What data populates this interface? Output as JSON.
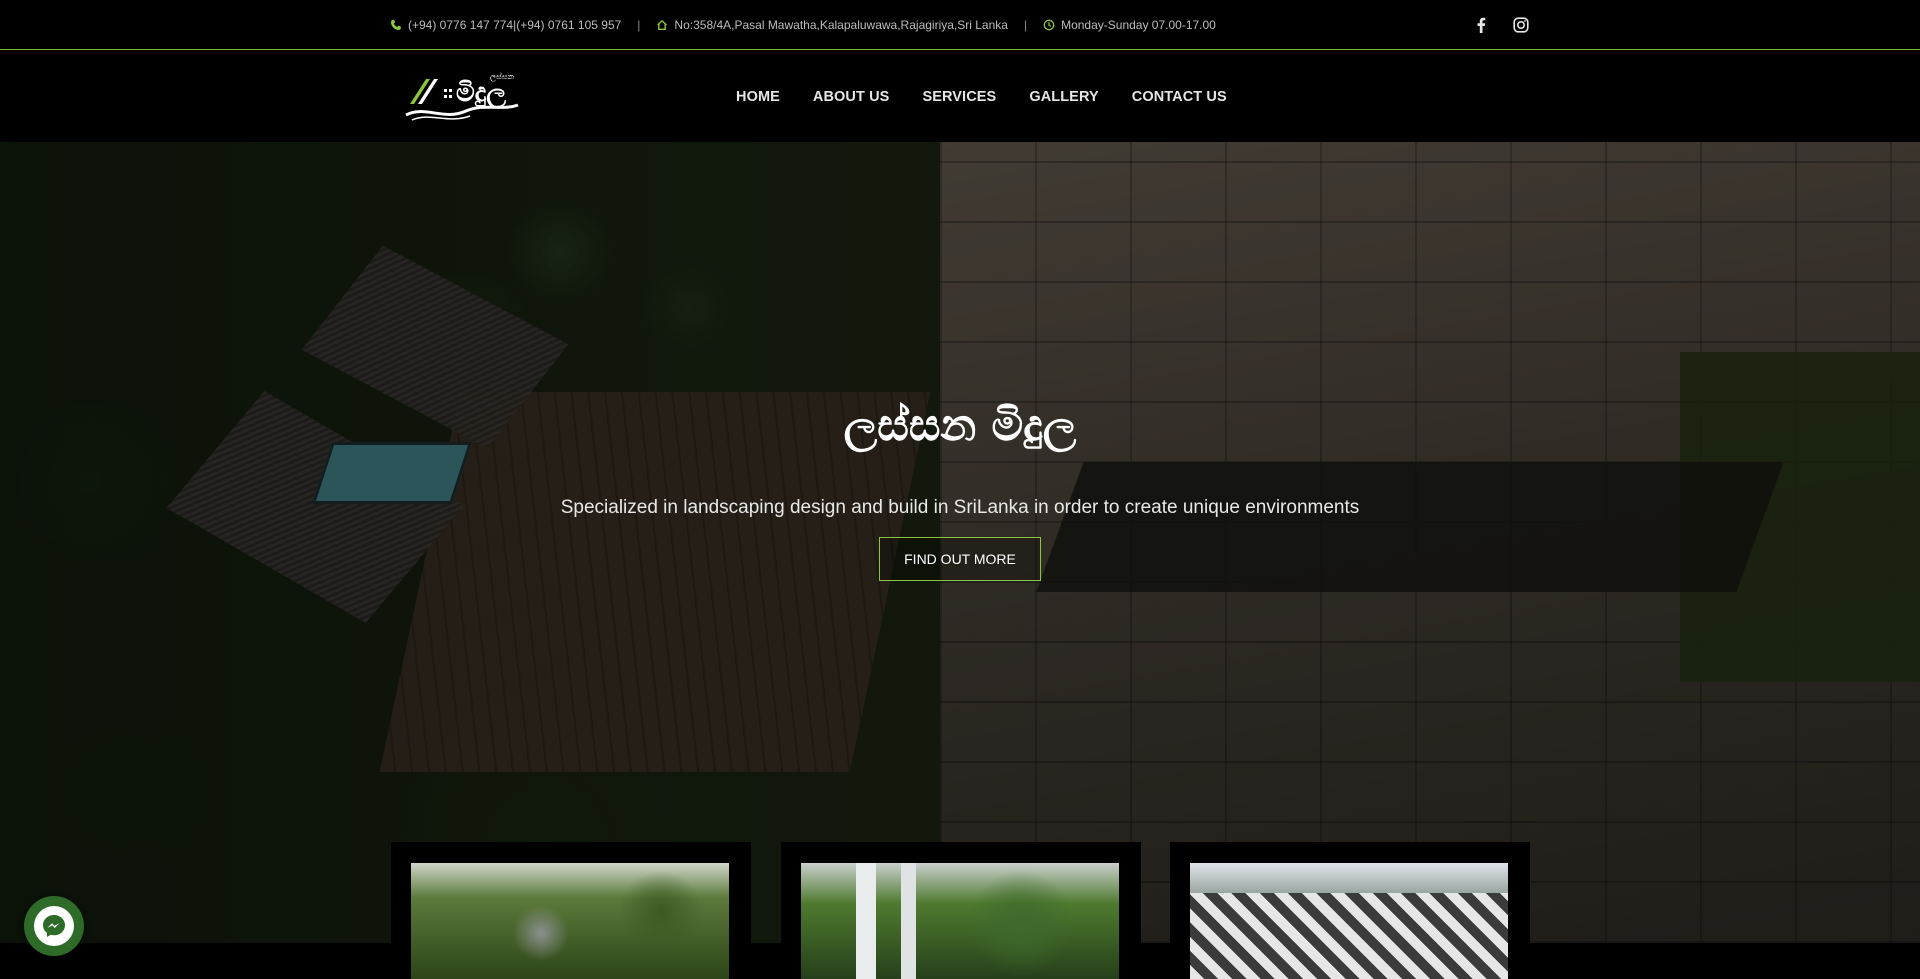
{
  "topbar": {
    "phone": "(+94) 0776 147 774|(+94) 0761 105 957",
    "address": "No:358/4A,Pasal Mawatha,Kalapaluwawa,Rajagiriya,Sri Lanka",
    "hours": "Monday-Sunday 07.00-17.00",
    "separator": "|",
    "social": [
      "facebook-icon",
      "instagram-icon"
    ]
  },
  "logo": {
    "text": "මිදුල",
    "small_text": "ලස්සන"
  },
  "nav": {
    "items": [
      "HOME",
      "ABOUT US",
      "SERVICES",
      "GALLERY",
      "CONTACT US"
    ]
  },
  "hero": {
    "title": "ලස්සන මිදුල",
    "subtitle": "Specialized in landscaping design and build in SriLanka in order to create unique environments",
    "button": "FIND OUT MORE"
  },
  "colors": {
    "accent": "#8cc63f",
    "topbar_border": "#7fb53a",
    "messenger": "#2e6b28"
  }
}
